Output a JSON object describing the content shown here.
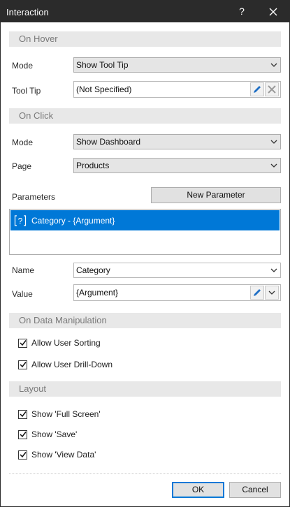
{
  "window": {
    "title": "Interaction",
    "help_label": "?"
  },
  "on_hover": {
    "section_title": "On Hover",
    "mode_label": "Mode",
    "mode_value": "Show Tool Tip",
    "tooltip_label": "Tool Tip",
    "tooltip_value": "(Not Specified)"
  },
  "on_click": {
    "section_title": "On Click",
    "mode_label": "Mode",
    "mode_value": "Show Dashboard",
    "page_label": "Page",
    "page_value": "Products",
    "parameters_label": "Parameters",
    "new_parameter_button": "New Parameter",
    "parameters": [
      {
        "label": "Category - {Argument}",
        "selected": true
      }
    ],
    "name_label": "Name",
    "name_value": "Category",
    "value_label": "Value",
    "value_value": "{Argument}"
  },
  "on_data_manipulation": {
    "section_title": "On Data Manipulation",
    "options": [
      {
        "label": "Allow User Sorting",
        "checked": true
      },
      {
        "label": "Allow User Drill-Down",
        "checked": true
      }
    ]
  },
  "layout": {
    "section_title": "Layout",
    "options": [
      {
        "label": "Show 'Full Screen'",
        "checked": true
      },
      {
        "label": "Show 'Save'",
        "checked": true
      },
      {
        "label": "Show 'View Data'",
        "checked": true
      }
    ]
  },
  "footer": {
    "ok_label": "OK",
    "cancel_label": "Cancel"
  },
  "colors": {
    "selection": "#0078d7",
    "titlebar": "#2b2b2b",
    "section_band": "#e8e8e8",
    "edit_icon": "#1f6fc5"
  },
  "icons": [
    "close-icon",
    "chevron-down-icon",
    "pencil-icon",
    "clear-icon",
    "parameter-icon",
    "checkmark-icon"
  ]
}
